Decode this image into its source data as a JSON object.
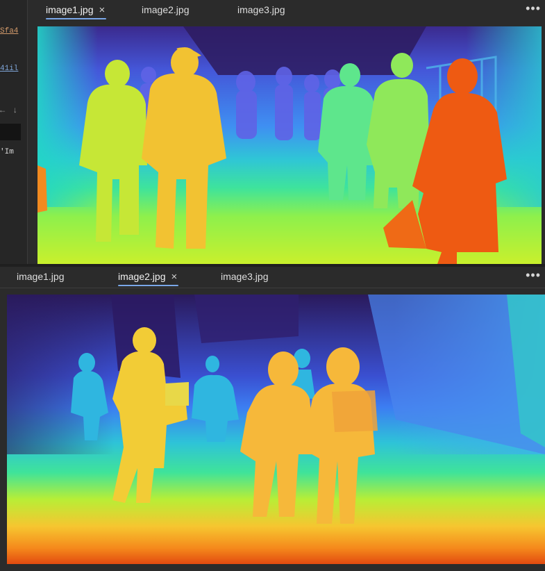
{
  "sidebar_fragments": {
    "line1": "Sfa4",
    "line2": "41il",
    "line3_icon": "←",
    "line3_arrow": "↓",
    "line4": "'Im"
  },
  "top_editor": {
    "tabs": [
      {
        "label": "image1.jpg",
        "active": true
      },
      {
        "label": "image2.jpg",
        "active": false
      },
      {
        "label": "image3.jpg",
        "active": false
      }
    ],
    "close_glyph": "×",
    "more_glyph": "•••"
  },
  "bottom_editor": {
    "tabs": [
      {
        "label": "image1.jpg",
        "active": false
      },
      {
        "label": "image2.jpg",
        "active": true
      },
      {
        "label": "image3.jpg",
        "active": false
      }
    ],
    "close_glyph": "×",
    "more_glyph": "•••"
  },
  "colors": {
    "panel_bg": "#2b2b2b",
    "active_tab_underline": "#7aa7e8",
    "depth_far": "#2d1b5e",
    "depth_mid": "#3b7cf0",
    "depth_near": "#e04a10"
  }
}
